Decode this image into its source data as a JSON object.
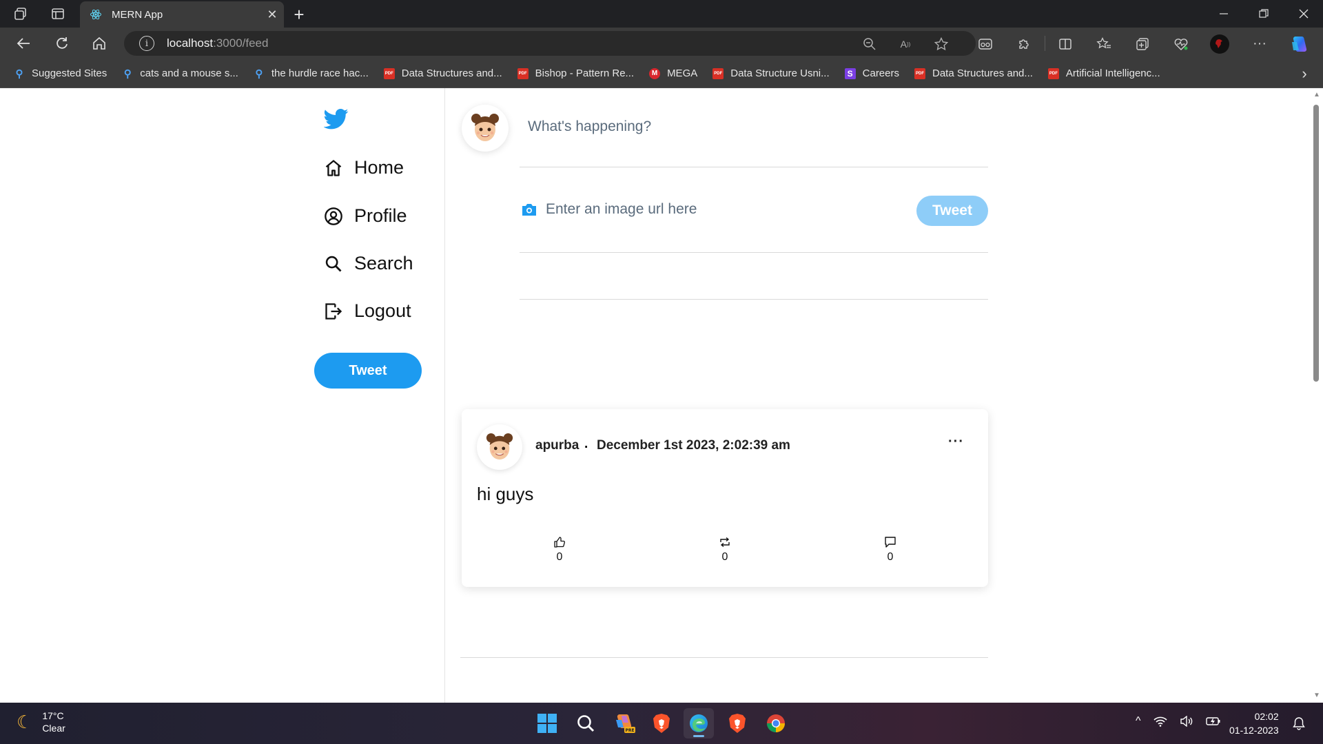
{
  "browser": {
    "tab_title": "MERN App",
    "tab_close": "✕",
    "new_tab": "+",
    "url_host": "localhost",
    "url_path": ":3000/feed",
    "more_menu": "···",
    "bookmarks": [
      {
        "label": "Suggested Sites",
        "icon": "search-icon"
      },
      {
        "label": "cats and a mouse s...",
        "icon": "search-icon"
      },
      {
        "label": "the hurdle race hac...",
        "icon": "search-icon"
      },
      {
        "label": "Data Structures and...",
        "icon": "pdf-icon"
      },
      {
        "label": "Bishop - Pattern Re...",
        "icon": "pdf-icon"
      },
      {
        "label": "MEGA",
        "icon": "mega-icon"
      },
      {
        "label": "Data Structure Usni...",
        "icon": "pdf-icon"
      },
      {
        "label": "Careers",
        "icon": "s-icon"
      },
      {
        "label": "Data Structures and...",
        "icon": "pdf-icon"
      },
      {
        "label": "Artificial Intelligenc...",
        "icon": "pdf-icon"
      }
    ],
    "bookmarks_more": "›"
  },
  "sidebar": {
    "nav": [
      {
        "label": "Home",
        "icon": "home-icon"
      },
      {
        "label": "Profile",
        "icon": "profile-icon"
      },
      {
        "label": "Search",
        "icon": "search-icon"
      },
      {
        "label": "Logout",
        "icon": "logout-icon"
      }
    ],
    "tweet_button": "Tweet"
  },
  "composer": {
    "placeholder": "What's happening?",
    "image_placeholder": "Enter an image url here",
    "tweet_button": "Tweet"
  },
  "feed": {
    "posts": [
      {
        "author": "apurba",
        "separator": ".",
        "date": "December 1st 2023, 2:02:39 am",
        "menu": "···",
        "text": "hi guys",
        "likes": "0",
        "retweets": "0",
        "comments": "0"
      }
    ]
  },
  "taskbar": {
    "temperature": "17°C",
    "condition": "Clear",
    "time": "02:02",
    "date": "01-12-2023",
    "tray_chevron": "^"
  },
  "colors": {
    "twitter_blue": "#1d9bf0",
    "tweet_disabled": "#8ecdf8"
  }
}
